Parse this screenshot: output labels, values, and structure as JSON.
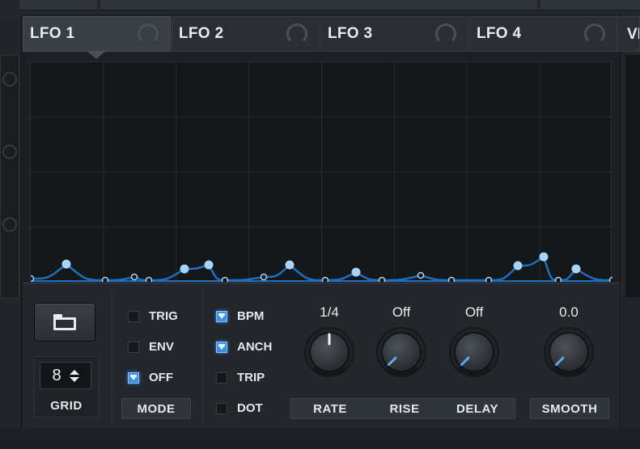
{
  "tabs": [
    {
      "label": "LFO 1",
      "active": true
    },
    {
      "label": "LFO 2",
      "active": false
    },
    {
      "label": "LFO 3",
      "active": false
    },
    {
      "label": "LFO 4",
      "active": false
    }
  ],
  "next_tab_partial": "VI",
  "grid": {
    "value": "8",
    "label": "GRID"
  },
  "mode": {
    "label": "MODE",
    "options": [
      {
        "label": "TRIG",
        "checked": false
      },
      {
        "label": "ENV",
        "checked": false
      },
      {
        "label": "OFF",
        "checked": true
      }
    ]
  },
  "timing": {
    "options": [
      {
        "label": "BPM",
        "checked": true
      },
      {
        "label": "ANCH",
        "checked": true
      },
      {
        "label": "TRIP",
        "checked": false
      },
      {
        "label": "DOT",
        "checked": false
      }
    ]
  },
  "knobs": {
    "rate": {
      "label": "RATE",
      "value": "1/4"
    },
    "rise": {
      "label": "RISE",
      "value": "Off"
    },
    "delay": {
      "label": "DELAY",
      "value": "Off"
    },
    "smooth": {
      "label": "SMOOTH",
      "value": "0.0"
    }
  },
  "colors": {
    "accent": "#3f8ee0",
    "curve": "#1f6fbf",
    "point": "#a8d4f7"
  }
}
